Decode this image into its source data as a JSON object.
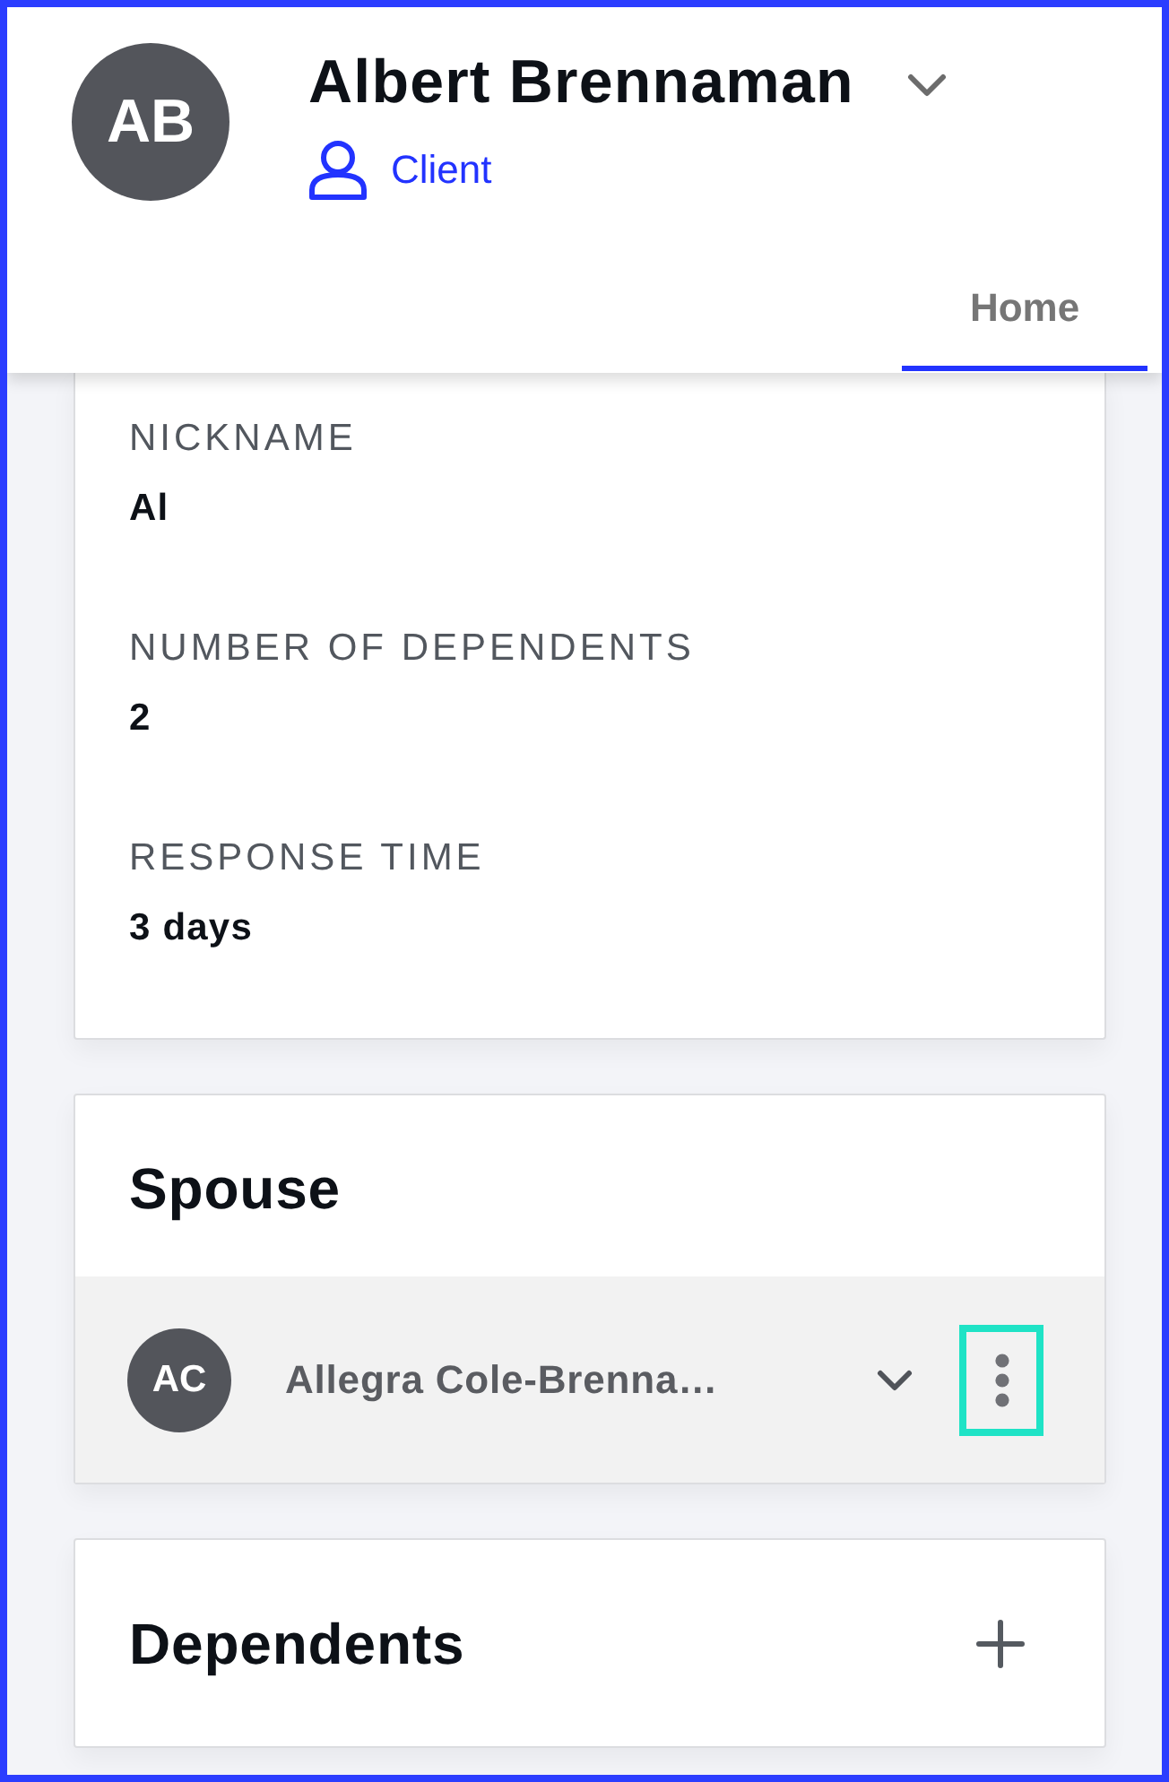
{
  "profile": {
    "initials": "AB",
    "name": "Albert Brennaman",
    "role": "Client"
  },
  "tabs": [
    {
      "label": "Home",
      "selected": true
    }
  ],
  "details": [
    {
      "label": "NICKNAME",
      "value": "Al"
    },
    {
      "label": "NUMBER OF DEPENDENTS",
      "value": "2"
    },
    {
      "label": "RESPONSE TIME",
      "value": "3 days"
    }
  ],
  "spouse": {
    "title": "Spouse",
    "members": [
      {
        "initials": "AC",
        "name": "Allegra Cole-Brenna…",
        "menu_focused": true
      }
    ]
  },
  "dependents": {
    "title": "Dependents"
  }
}
